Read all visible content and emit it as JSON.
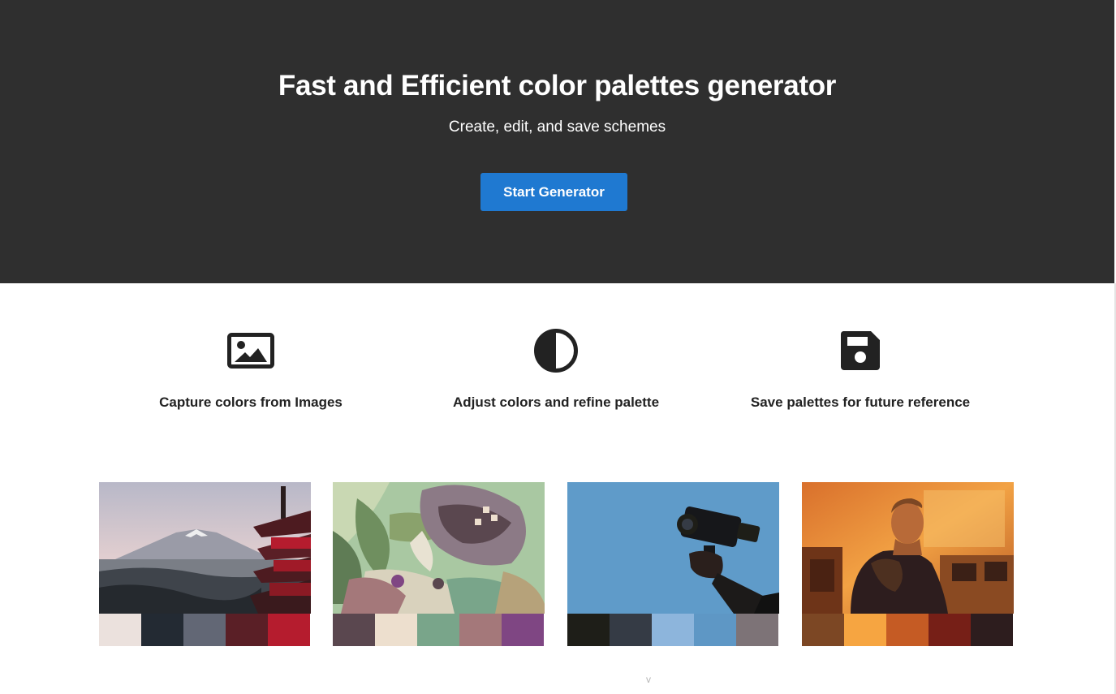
{
  "hero": {
    "title": "Fast and Efficient color palettes generator",
    "subtitle": "Create, edit, and save schemes",
    "cta_label": "Start Generator",
    "background": "#2f2f2f",
    "accent": "#1f79d1"
  },
  "features": [
    {
      "icon": "image-icon",
      "label": "Capture colors from Images"
    },
    {
      "icon": "contrast-icon",
      "label": "Adjust colors and refine palette"
    },
    {
      "icon": "floppy-disk-icon",
      "label": "Save palettes for future reference"
    }
  ],
  "examples": [
    {
      "subject": "mount-fuji-pagoda-photo",
      "colors": [
        "#ebe1dd",
        "#232a33",
        "#626775",
        "#5a1f26",
        "#b51c2e"
      ]
    },
    {
      "subject": "wolf-illustration",
      "colors": [
        "#5a474f",
        "#eddfce",
        "#79a58a",
        "#a4787a",
        "#7f4683"
      ]
    },
    {
      "subject": "hand-holding-camera-photo",
      "colors": [
        "#1e1e18",
        "#353b45",
        "#8db5dc",
        "#5e97c5",
        "#7d7377"
      ]
    },
    {
      "subject": "man-in-orange-office-photo",
      "colors": [
        "#7c4724",
        "#f6a541",
        "#c55b24",
        "#761f17",
        "#2d1d1e"
      ]
    }
  ],
  "scroll_hint": "v"
}
